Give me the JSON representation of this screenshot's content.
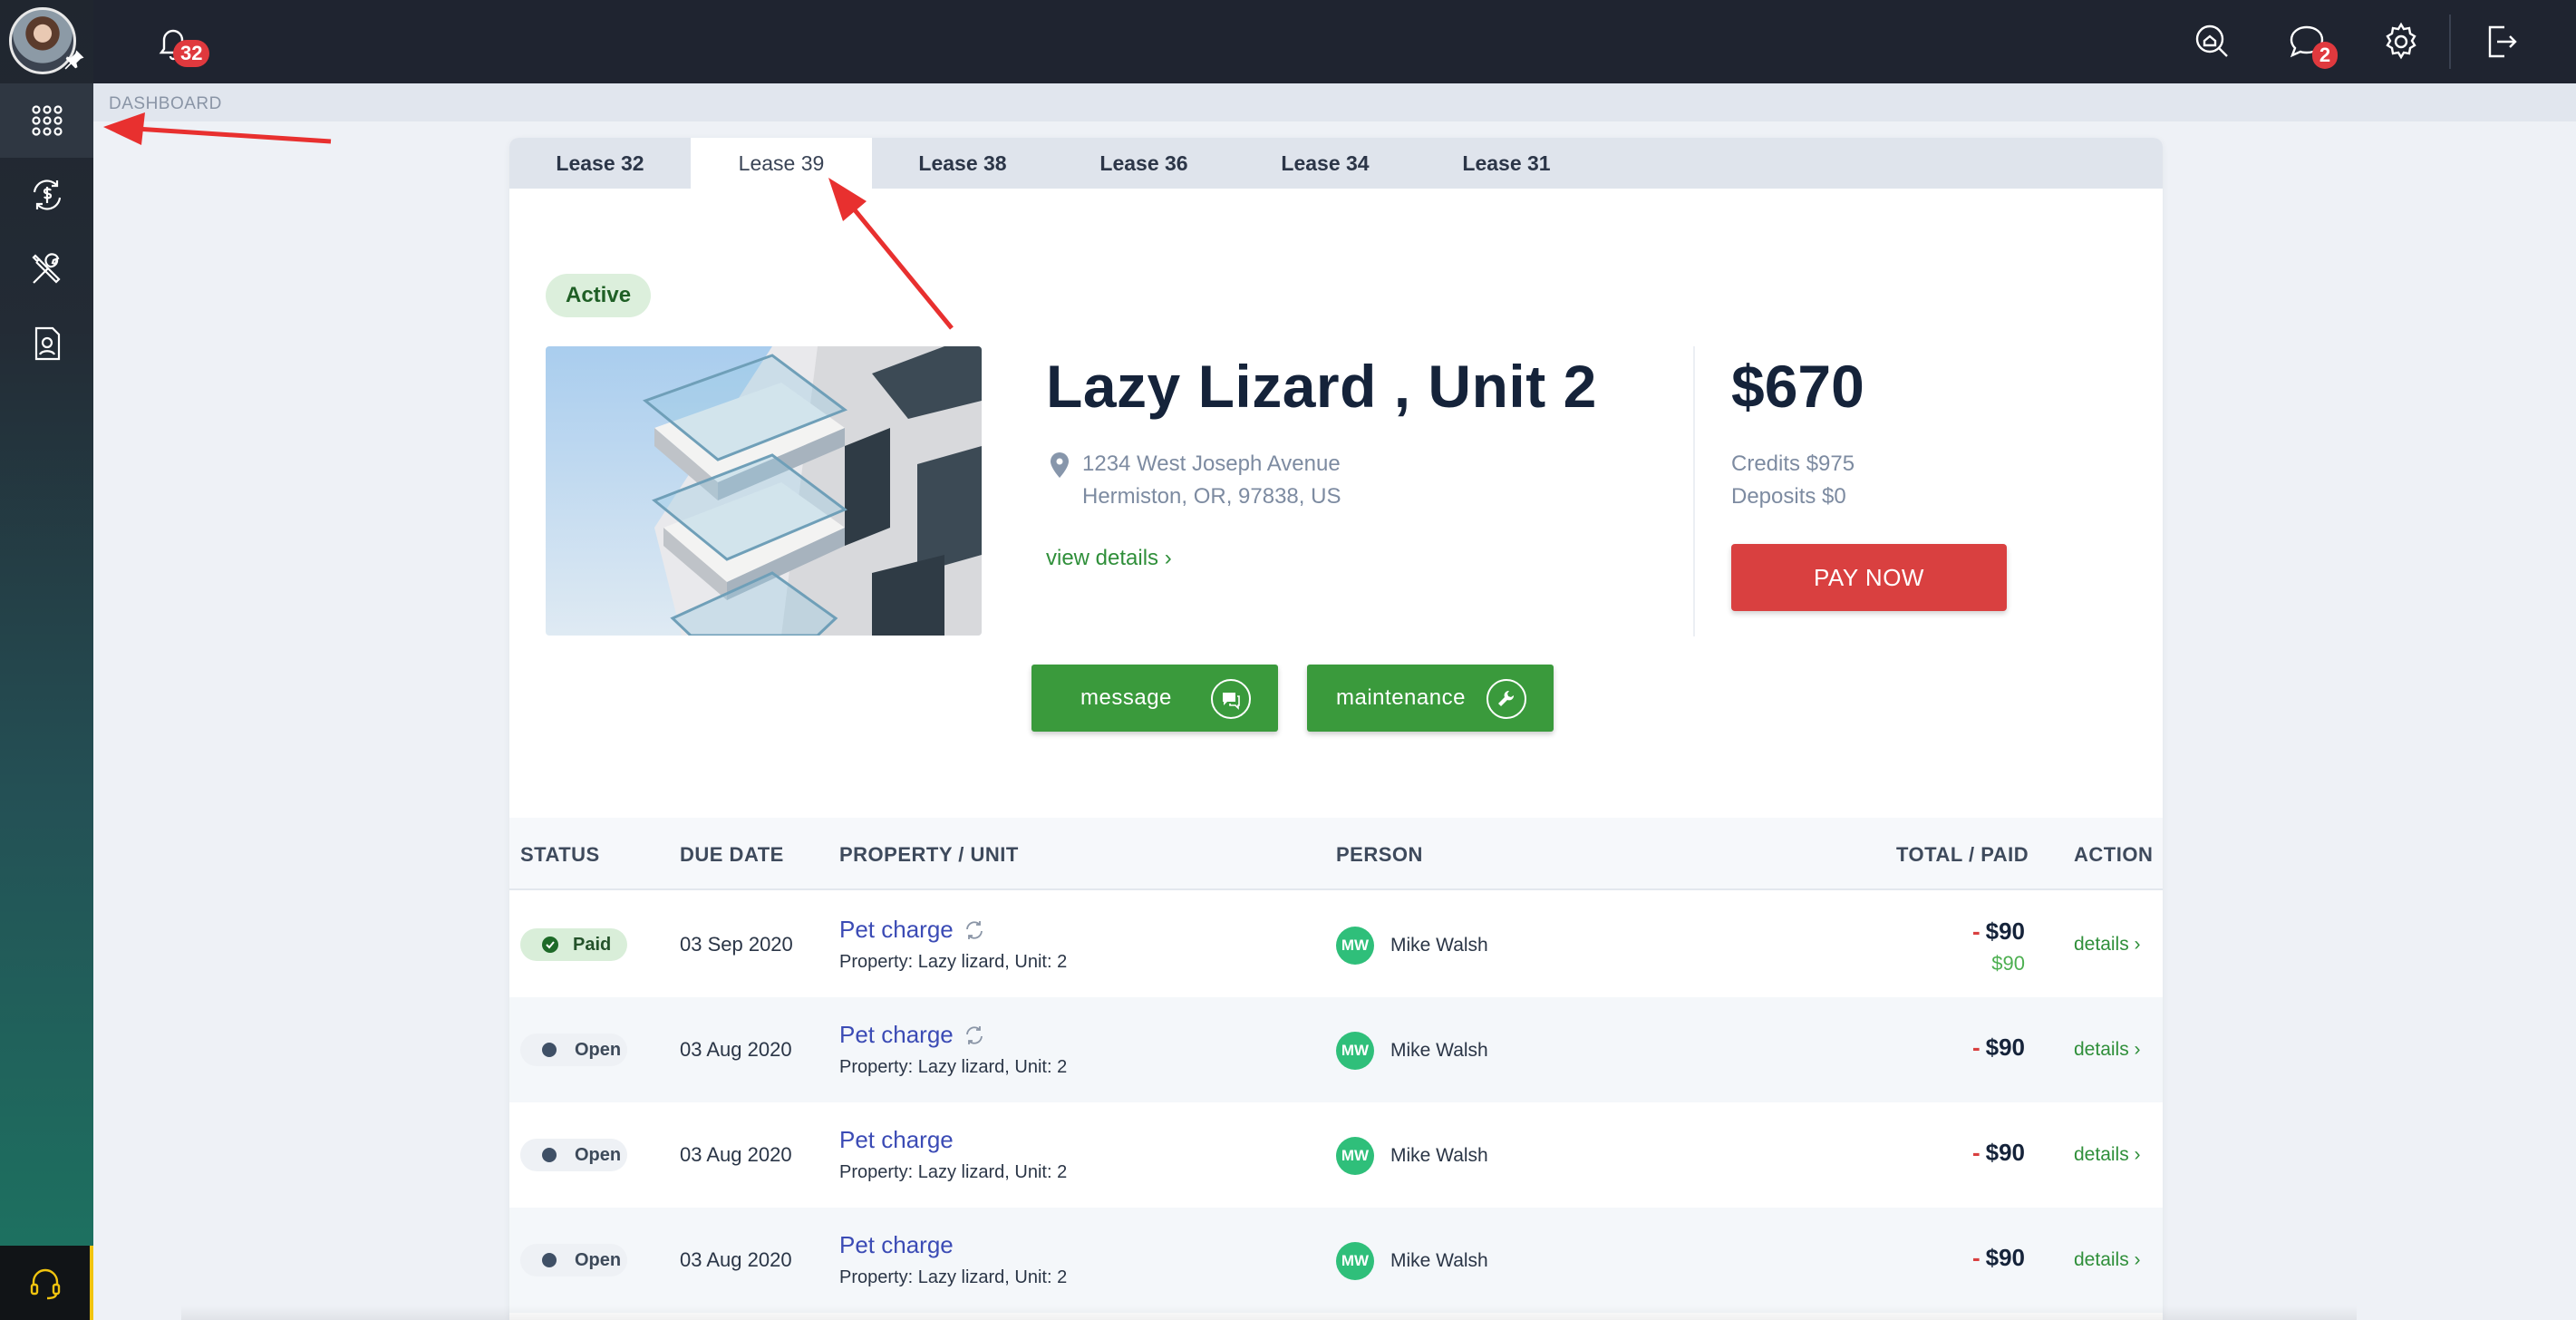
{
  "topbar": {
    "notification_count": "32",
    "messages_count": "2"
  },
  "breadcrumb": "DASHBOARD",
  "tabs": [
    {
      "label": "Lease 32",
      "active": false
    },
    {
      "label": "Lease 39",
      "active": true
    },
    {
      "label": "Lease 38",
      "active": false
    },
    {
      "label": "Lease 36",
      "active": false
    },
    {
      "label": "Lease 34",
      "active": false
    },
    {
      "label": "Lease 31",
      "active": false
    }
  ],
  "lease": {
    "status": "Active",
    "title": "Lazy Lizard , Unit 2",
    "address_line1": "1234 West Joseph Avenue",
    "address_line2": "Hermiston, OR, 97838, US",
    "view_details": "view details ›",
    "amount": "$670",
    "credits": "Credits $975",
    "deposits": "Deposits $0",
    "pay_label": "PAY NOW",
    "message_label": "message",
    "maintenance_label": "maintenance"
  },
  "table": {
    "headers": {
      "status": "STATUS",
      "due_date": "DUE DATE",
      "property_unit": "PROPERTY / UNIT",
      "person": "PERSON",
      "total_paid": "TOTAL / PAID",
      "action": "ACTION"
    },
    "rows": [
      {
        "status": "Paid",
        "due": "03 Sep 2020",
        "charge": "Pet charge",
        "recurring": true,
        "property": "Property: Lazy lizard, Unit: 2",
        "initials": "MW",
        "person": "Mike Walsh",
        "sign": "-",
        "total": "$90",
        "paid": "$90",
        "action": "details ›"
      },
      {
        "status": "Open",
        "due": "03 Aug 2020",
        "charge": "Pet charge",
        "recurring": true,
        "property": "Property: Lazy lizard, Unit: 2",
        "initials": "MW",
        "person": "Mike Walsh",
        "sign": "-",
        "total": "$90",
        "paid": "",
        "action": "details ›"
      },
      {
        "status": "Open",
        "due": "03 Aug 2020",
        "charge": "Pet charge",
        "recurring": false,
        "property": "Property: Lazy lizard, Unit: 2",
        "initials": "MW",
        "person": "Mike Walsh",
        "sign": "-",
        "total": "$90",
        "paid": "",
        "action": "details ›"
      },
      {
        "status": "Open",
        "due": "03 Aug 2020",
        "charge": "Pet charge",
        "recurring": false,
        "property": "Property: Lazy lizard, Unit: 2",
        "initials": "MW",
        "person": "Mike Walsh",
        "sign": "-",
        "total": "$90",
        "paid": "",
        "action": "details ›"
      }
    ]
  },
  "colors": {
    "accent_green": "#3a9a3c",
    "pay_red": "#d94040",
    "link_blue": "#3b4bb5",
    "annotation_red": "#e8302f"
  }
}
